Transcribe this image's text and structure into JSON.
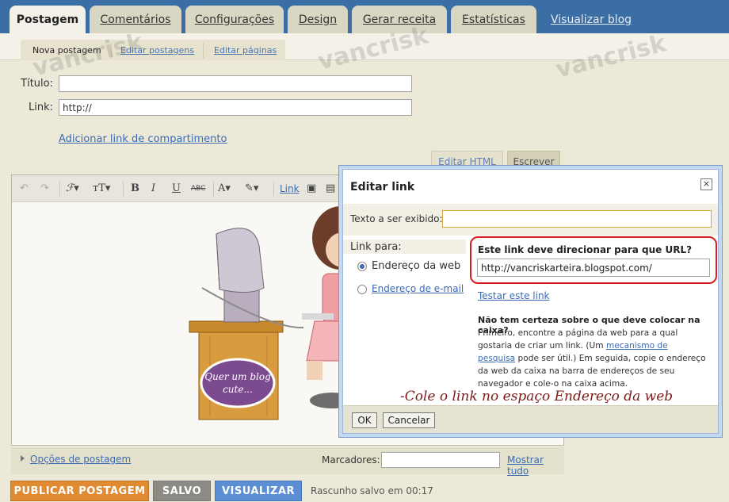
{
  "nav": {
    "tabs": [
      {
        "label": "Postagem",
        "active": true
      },
      {
        "label": "Comentários"
      },
      {
        "label": "Configurações"
      },
      {
        "label": "Design"
      },
      {
        "label": "Gerar receita"
      },
      {
        "label": "Estatísticas"
      }
    ],
    "view_blog": "Visualizar blog",
    "subtabs": [
      {
        "label": "Nova postagem",
        "active": true
      },
      {
        "label": "Editar postagens"
      },
      {
        "label": "Editar páginas"
      }
    ]
  },
  "form": {
    "title_label": "Título:",
    "title_value": "",
    "link_label": "Link:",
    "link_value": "http://",
    "share_link": "Adicionar link de compartimento",
    "edit_html": "Editar HTML",
    "write": "Escrever"
  },
  "editor": {
    "toolbar_link": "Link",
    "image_text_line1": "Quer um blog",
    "image_text_line2": "cute...",
    "post_options": "Opções de postagem",
    "labels_label": "Marcadores:",
    "labels_value": "",
    "show_all": "Mostrar tudo"
  },
  "actions": {
    "publish": "PUBLICAR POSTAGEM",
    "saved": "SALVO",
    "preview": "VISUALIZAR",
    "autosave": "Rascunho salvo em 00:17"
  },
  "watermark": [
    "vancrisk",
    "vancrisk",
    "vancrisk"
  ],
  "dialog": {
    "title": "Editar link",
    "close_icon": "×",
    "text_label": "Texto a ser exibido:",
    "text_value": "",
    "link_to_label": "Link para:",
    "option_web": "Endereço da web",
    "option_email": "Endereço de e-mail",
    "url_heading": "Este link deve direcionar para que URL?",
    "url_value": "http://vancriskarteira.blogspot.com/",
    "test_link": "Testar este link",
    "help_title": "Não tem certeza sobre o que deve colocar na caixa?",
    "help_part1": "Primeiro, encontre a página da web para a qual gostaria de criar um link. (Um ",
    "help_link": "mecanismo de pesquisa",
    "help_part2": " pode ser útil.) Em seguida, copie o endereço da web da caixa na barra de endereços de seu navegador e cole-o na caixa acima.",
    "annotation": "-Cole o link no espaço Endereço da web",
    "ok": "OK",
    "cancel": "Cancelar"
  },
  "colors": {
    "topbar": "#3a6ea5",
    "publish": "#e08a32",
    "preview": "#5c8ed3",
    "highlight": "#d71d1d",
    "link": "#3b6cb3"
  }
}
